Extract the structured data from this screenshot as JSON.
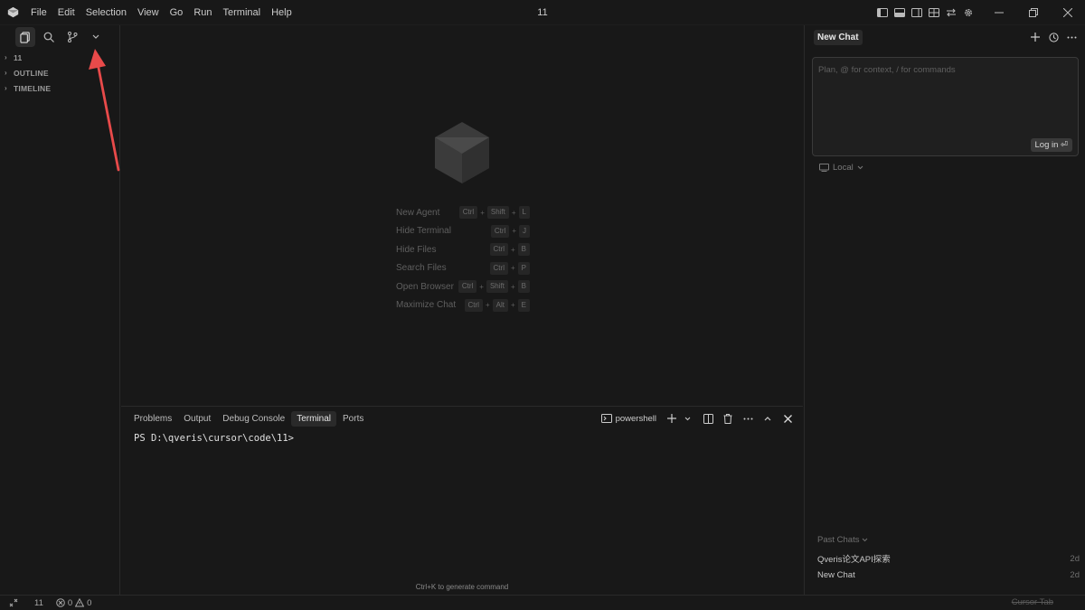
{
  "titlebar": {
    "menu": [
      "File",
      "Edit",
      "Selection",
      "View",
      "Go",
      "Run",
      "Terminal",
      "Help"
    ],
    "title": "11"
  },
  "sidebar": {
    "sections": [
      {
        "label": "11"
      },
      {
        "label": "OUTLINE"
      },
      {
        "label": "TIMELINE"
      }
    ]
  },
  "editor": {
    "shortcuts": [
      {
        "label": "New Agent",
        "keys": [
          "Ctrl",
          "Shift",
          "L"
        ]
      },
      {
        "label": "Hide Terminal",
        "keys": [
          "Ctrl",
          "J"
        ]
      },
      {
        "label": "Hide Files",
        "keys": [
          "Ctrl",
          "B"
        ]
      },
      {
        "label": "Search Files",
        "keys": [
          "Ctrl",
          "P"
        ]
      },
      {
        "label": "Open Browser",
        "keys": [
          "Ctrl",
          "Shift",
          "B"
        ]
      },
      {
        "label": "Maximize Chat",
        "keys": [
          "Ctrl",
          "Alt",
          "E"
        ]
      }
    ]
  },
  "panel": {
    "tabs": [
      "Problems",
      "Output",
      "Debug Console",
      "Terminal",
      "Ports"
    ],
    "active_tab": "Terminal",
    "shell": "powershell",
    "prompt": "PS D:\\qveris\\cursor\\code\\11>",
    "hint": "Ctrl+K to generate command"
  },
  "chat": {
    "tab": "New Chat",
    "placeholder": "Plan, @ for context, / for commands",
    "login": "Log in ⏎",
    "mode": "Local",
    "past_title": "Past Chats",
    "past": [
      {
        "name": "Qveris论文API探索",
        "time": "2d"
      },
      {
        "name": "New Chat",
        "time": "2d"
      }
    ]
  },
  "statusbar": {
    "workspace": "11",
    "errors": "0",
    "warnings": "0",
    "right": "Cursor Tab"
  },
  "colors": {
    "background": "#181818",
    "accent_annotation": "#e84a4a"
  }
}
